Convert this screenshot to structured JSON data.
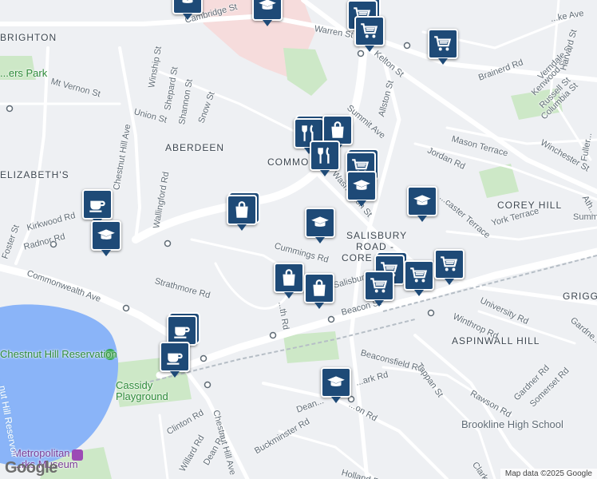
{
  "map": {
    "attribution": "Map data ©2025 Google",
    "logo": "Google",
    "colors": {
      "poi_fill": "#1e4a77",
      "park": "#cde8c7",
      "water": "#8ab4f8",
      "campus": "#f6dcdc",
      "road": "#ffffff"
    },
    "neighborhoods": [
      "ABERDEEN",
      "COMMON",
      "ELIZABETH'S",
      "COREY HILL",
      "SALISBURY",
      "ROAD -",
      "CORE",
      "GRIGGS",
      "ASPINWALL HILL",
      "BRIGHTON"
    ],
    "parks": [
      "Chestnut Hill Reservation",
      "Cassidy Playground",
      "...ers Park",
      "Metropolitan",
      "...rks Museum",
      "Brookline High School"
    ],
    "water_labels": [
      "...nut Hill Reservoir",
      "Chestnut Hill Reservoir"
    ],
    "streets": [
      "Cambridge St",
      "Warren St",
      "Kelton St",
      "Brainerd Rd",
      "Verndale St",
      "Kenwood St",
      "Russell St",
      "Columbia St",
      "Harvard St",
      "...ke Ave",
      "Mt Vernon St",
      "Winship St",
      "Shepard St",
      "Shannon St",
      "Snow St",
      "Union St",
      "Chestnut Hill Ave",
      "Wallingford Rd",
      "Summit Ave",
      "Allston St",
      "Mason Terrace",
      "Jordan Rd",
      "Winchester St",
      "Fuller...",
      "Ath...",
      "Kirkwood Rd",
      "Foster St",
      "Radnor Rd",
      "Commonwealth Ave",
      "Washington St",
      "...caster Terrace",
      "York Terrace",
      "Summ...",
      "Cummings Rd",
      "Strathmore Rd",
      "...th Rd",
      "Salisbury...",
      "Beacon St",
      "Winthrop Rd",
      "University Rd",
      "Gardne...",
      "Beaconsfield Rd",
      "Tappan St",
      "Rawson Rd",
      "Gardner Rd",
      "Somerset Rd",
      "Dean Rd",
      "Clinton Rd",
      "Buckminster Rd",
      "Willard Rd",
      "Holland Rd",
      "Clark Rd",
      "Chestnut Hill Ave",
      "...ark Rd",
      "Dean...",
      "...on Rd",
      "Chestnut..."
    ],
    "markers": [
      {
        "type": "cafe",
        "label": "coffee-shop"
      },
      {
        "type": "school",
        "label": "school"
      },
      {
        "type": "grocery",
        "label": "grocery-store"
      },
      {
        "type": "restaurant",
        "label": "restaurant"
      },
      {
        "type": "shopping",
        "label": "shopping-bag"
      }
    ]
  }
}
